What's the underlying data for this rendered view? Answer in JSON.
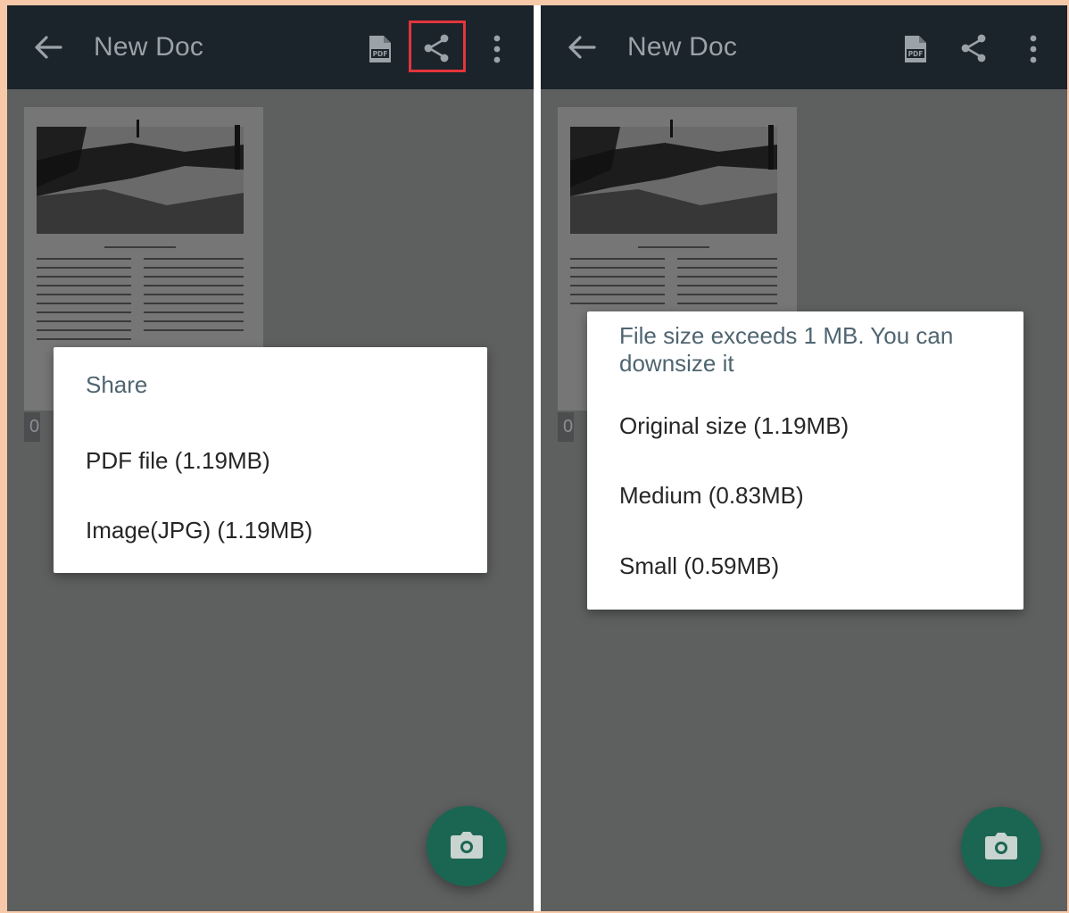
{
  "colors": {
    "background_accent": "#f7c9a9",
    "app_bar": "#1b232b",
    "scrim": "#5e5f5f",
    "fab": "#1b6652",
    "highlight": "#e3353a",
    "dialog_heading": "#4f6571"
  },
  "icons": {
    "back": "arrow-left-icon",
    "pdf": "pdf-file-icon",
    "share": "share-icon",
    "more": "more-vert-icon",
    "camera": "camera-icon"
  },
  "left_screen": {
    "app_bar": {
      "title": "New Doc"
    },
    "page_label": "01",
    "share_dialog": {
      "title": "Share",
      "options": [
        {
          "label": "PDF file (1.19MB)"
        },
        {
          "label": "Image(JPG) (1.19MB)"
        }
      ]
    }
  },
  "right_screen": {
    "app_bar": {
      "title": "New Doc"
    },
    "page_label": "01",
    "size_dialog": {
      "title": "File size exceeds 1 MB. You can downsize it",
      "options": [
        {
          "label": "Original size (1.19MB)"
        },
        {
          "label": "Medium (0.83MB)"
        },
        {
          "label": "Small (0.59MB)"
        }
      ]
    }
  }
}
